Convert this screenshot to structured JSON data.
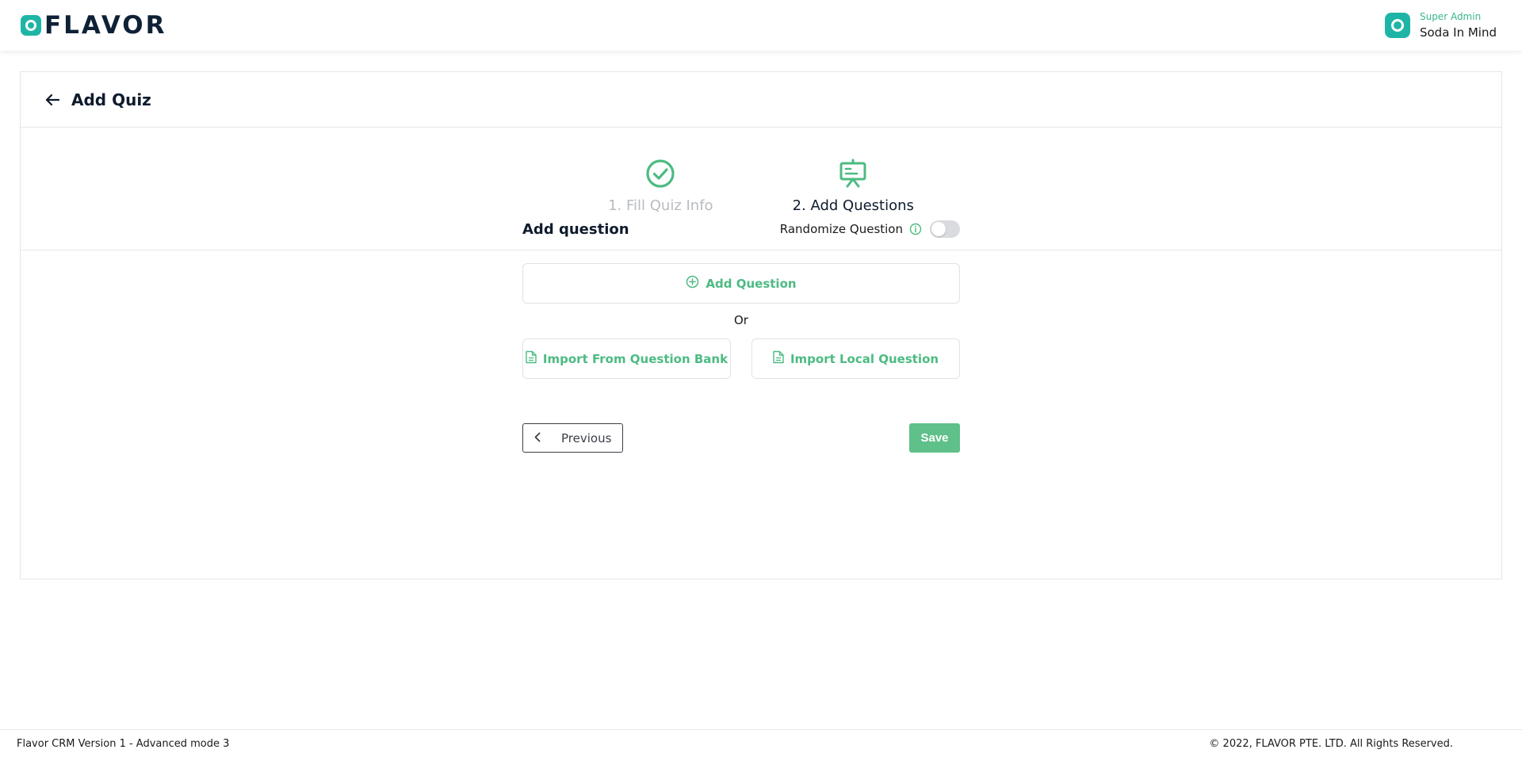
{
  "header": {
    "logo_text": "FLAVOR",
    "user": {
      "role": "Super Admin",
      "name": "Soda In Mind"
    }
  },
  "page": {
    "title": "Add Quiz"
  },
  "stepper": {
    "steps": [
      {
        "label": "1. Fill Quiz Info",
        "state": "done",
        "icon": "check-circle-icon"
      },
      {
        "label": "2. Add Questions",
        "state": "active",
        "icon": "presentation-board-icon"
      }
    ]
  },
  "question_section": {
    "title": "Add question",
    "randomize_label": "Randomize Question",
    "randomize_on": false,
    "add_question_label": "Add Question",
    "or_text": "Or",
    "import_bank_label": "Import From Question Bank",
    "import_local_label": "Import Local Question"
  },
  "actions": {
    "previous_label": "Previous",
    "save_label": "Save"
  },
  "footer": {
    "version": "Flavor CRM Version 1 - Advanced mode 3",
    "copyright": "© 2022, FLAVOR PTE. LTD. All Rights Reserved."
  },
  "colors": {
    "brand_teal": "#1fb5a6",
    "accent_green": "#4cbb82",
    "save_green": "#5fc08a",
    "text_dark": "#0f1b2d",
    "text_muted": "#b8bcc2"
  }
}
